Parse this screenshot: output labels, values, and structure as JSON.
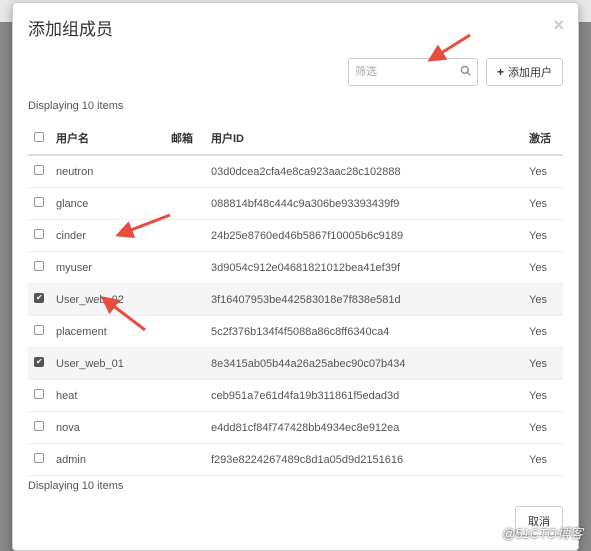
{
  "modal": {
    "title": "添加组成员",
    "close_label": "×"
  },
  "toolbar": {
    "search_placeholder": "筛选",
    "add_user_label": "添加用户",
    "plus": "+"
  },
  "count_top": "Displaying 10 items",
  "count_bottom": "Displaying 10 items",
  "headers": {
    "username": "用户名",
    "email": "邮箱",
    "user_id": "用户ID",
    "active": "激活"
  },
  "rows": [
    {
      "checked": false,
      "username": "neutron",
      "email": "",
      "user_id": "03d0dcea2cfa4e8ca923aac28c102888",
      "active": "Yes"
    },
    {
      "checked": false,
      "username": "glance",
      "email": "",
      "user_id": "088814bf48c444c9a306be93393439f9",
      "active": "Yes"
    },
    {
      "checked": false,
      "username": "cinder",
      "email": "",
      "user_id": "24b25e8760ed46b5867f10005b6c9189",
      "active": "Yes"
    },
    {
      "checked": false,
      "username": "myuser",
      "email": "",
      "user_id": "3d9054c912e04681821012bea41ef39f",
      "active": "Yes"
    },
    {
      "checked": true,
      "username": "User_web_02",
      "email": "",
      "user_id": "3f16407953be442583018e7f838e581d",
      "active": "Yes"
    },
    {
      "checked": false,
      "username": "placement",
      "email": "",
      "user_id": "5c2f376b134f4f5088a86c8ff6340ca4",
      "active": "Yes"
    },
    {
      "checked": true,
      "username": "User_web_01",
      "email": "",
      "user_id": "8e3415ab05b44a26a25abec90c07b434",
      "active": "Yes"
    },
    {
      "checked": false,
      "username": "heat",
      "email": "",
      "user_id": "ceb951a7e61d4fa19b311861f5edad3d",
      "active": "Yes"
    },
    {
      "checked": false,
      "username": "nova",
      "email": "",
      "user_id": "e4dd81cf84f747428bb4934ec8e912ea",
      "active": "Yes"
    },
    {
      "checked": false,
      "username": "admin",
      "email": "",
      "user_id": "f293e8224267489c8d1a05d9d2151616",
      "active": "Yes"
    }
  ],
  "footer": {
    "cancel_label": "取消"
  },
  "watermark": "@51CTO博客"
}
